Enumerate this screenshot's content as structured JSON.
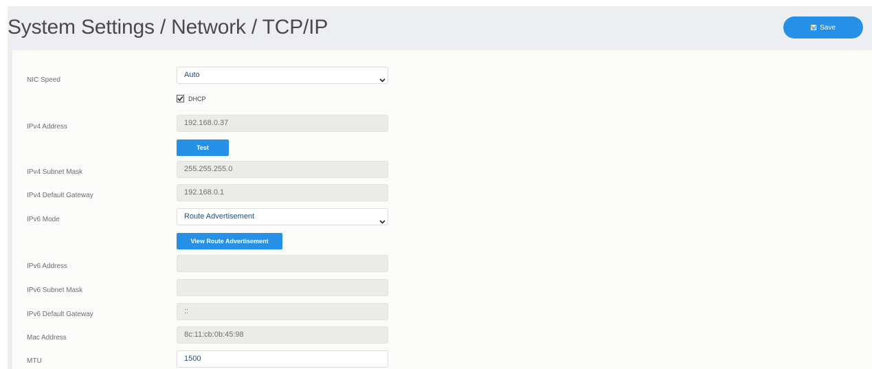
{
  "header": {
    "title": "System Settings / Network / TCP/IP",
    "save_label": "Save"
  },
  "form": {
    "nic_speed": {
      "label": "NIC Speed",
      "value": "Auto"
    },
    "dhcp": {
      "label": "DHCP",
      "checked": true
    },
    "ipv4_address": {
      "label": "IPv4 Address",
      "value": "192.168.0.37"
    },
    "test_button": "Test",
    "ipv4_subnet_mask": {
      "label": "IPv4 Subnet Mask",
      "value": "255.255.255.0"
    },
    "ipv4_default_gateway": {
      "label": "IPv4 Default Gateway",
      "value": "192.168.0.1"
    },
    "ipv6_mode": {
      "label": "IPv6 Mode",
      "value": "Route Advertisement"
    },
    "view_route_button": "View Route Advertisement",
    "ipv6_address": {
      "label": "IPv6 Address",
      "value": ""
    },
    "ipv6_subnet_mask": {
      "label": "IPv6 Subnet Mask",
      "value": ""
    },
    "ipv6_default_gateway": {
      "label": "IPv6 Default Gateway",
      "value": "::"
    },
    "mac_address": {
      "label": "Mac Address",
      "value": "8c:11:cb:0b:45:98"
    },
    "mtu": {
      "label": "MTU",
      "value": "1500"
    }
  },
  "colors": {
    "accent": "#2590e6",
    "background": "#eceef1",
    "panel": "#fbfbfa",
    "readonly_field": "#ebebe7",
    "value_text": "#1d4f86"
  }
}
